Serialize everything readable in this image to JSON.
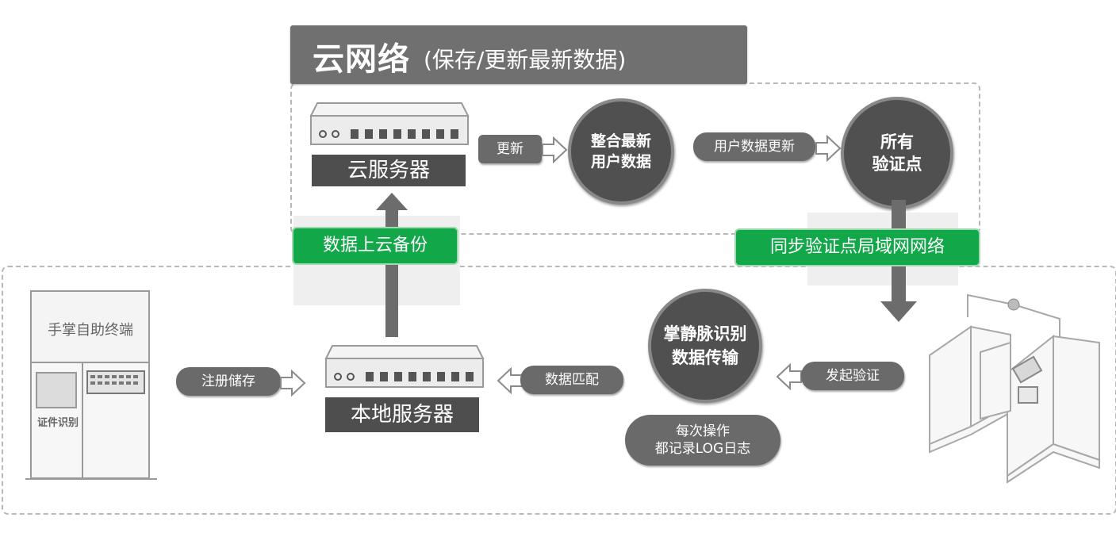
{
  "header": {
    "title": "云网络",
    "subtitle": "(保存/更新最新数据)"
  },
  "cloud": {
    "server_label": "云服务器",
    "update_label": "更新",
    "merge_circle": [
      "整合最新",
      "用户数据"
    ],
    "user_update_label": "用户数据更新",
    "all_points_circle": [
      "所有",
      "验证点"
    ]
  },
  "links": {
    "backup_label": "数据上云备份",
    "sync_label": "同步验证点局域网网络"
  },
  "local": {
    "server_label": "本地服务器",
    "register_label": "注册储存",
    "match_label": "数据匹配",
    "palm_circle": [
      "掌静脉识别",
      "数据传输"
    ],
    "verify_label": "发起验证",
    "log_lines": [
      "每次操作",
      "都记录LOG日志"
    ]
  },
  "kiosk": {
    "title": "手掌自助终端",
    "id_label": "证件识别"
  }
}
